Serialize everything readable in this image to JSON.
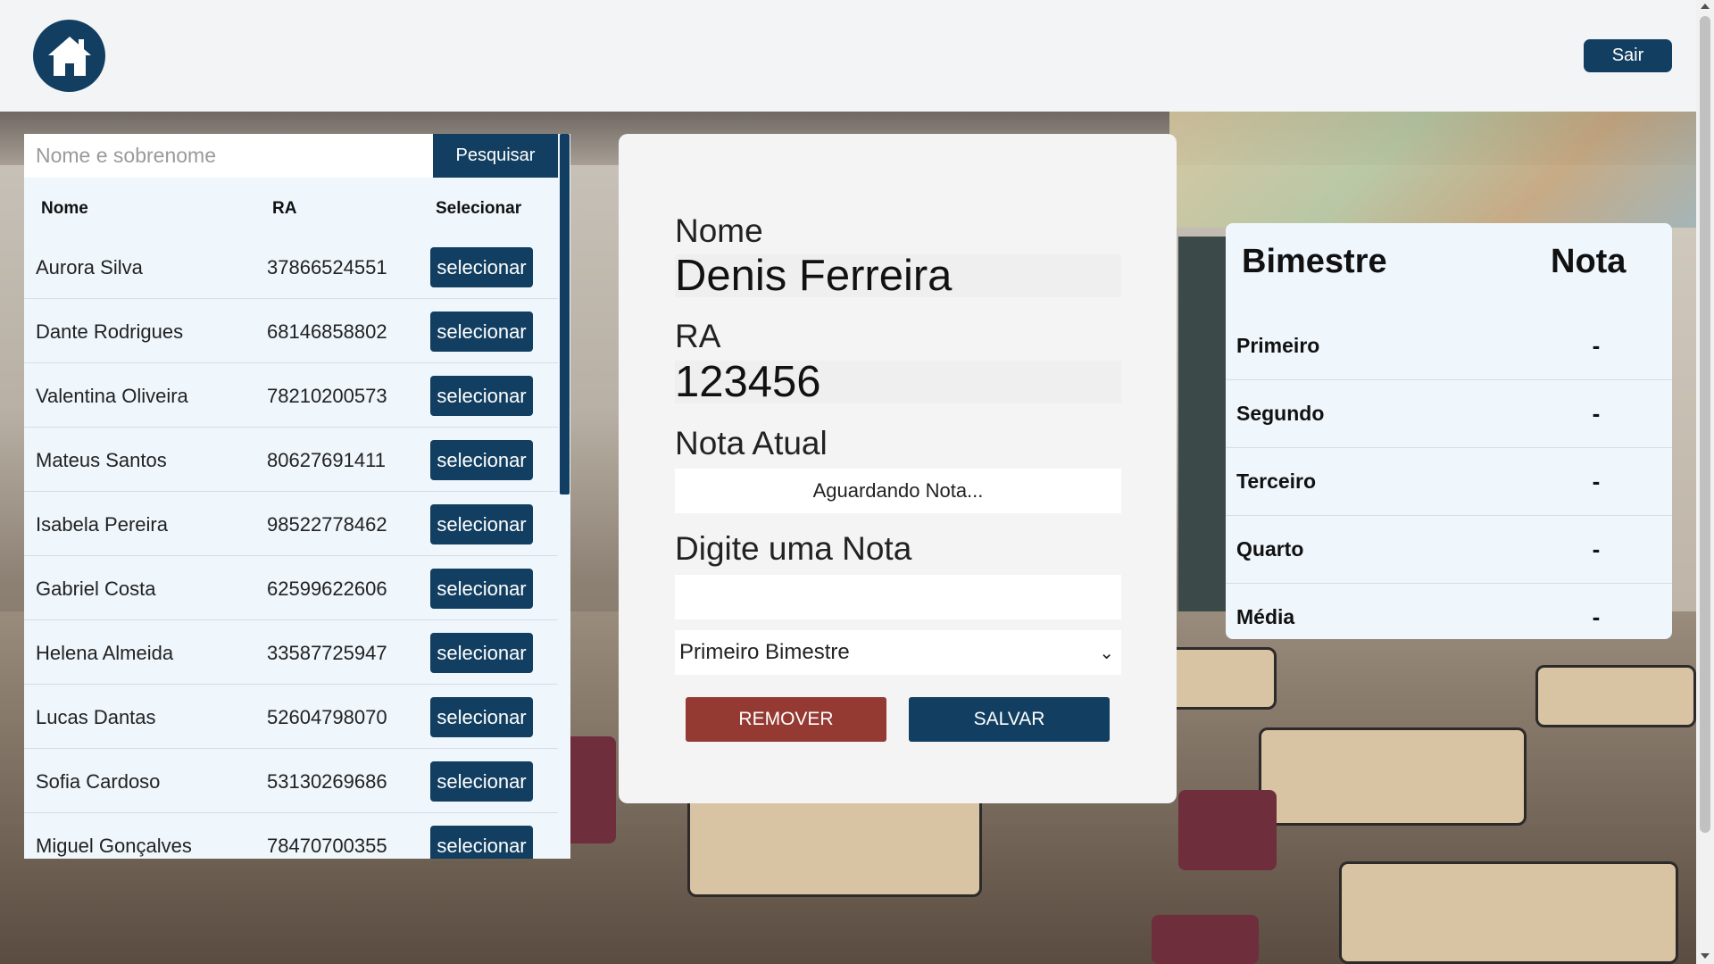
{
  "header": {
    "home_icon": "home-icon",
    "logout_label": "Sair"
  },
  "search": {
    "placeholder": "Nome e sobrenome",
    "button_label": "Pesquisar"
  },
  "students_table": {
    "columns": [
      "Nome",
      "RA",
      "Selecionar"
    ],
    "rows": [
      {
        "nome": "Aurora Silva",
        "ra": "37866524551",
        "action": "selecionar"
      },
      {
        "nome": "Dante Rodrigues",
        "ra": "68146858802",
        "action": "selecionar"
      },
      {
        "nome": "Valentina Oliveira",
        "ra": "78210200573",
        "action": "selecionar"
      },
      {
        "nome": "Mateus Santos",
        "ra": "80627691411",
        "action": "selecionar"
      },
      {
        "nome": "Isabela Pereira",
        "ra": "98522778462",
        "action": "selecionar"
      },
      {
        "nome": "Gabriel Costa",
        "ra": "62599622606",
        "action": "selecionar"
      },
      {
        "nome": "Helena Almeida",
        "ra": "33587725947",
        "action": "selecionar"
      },
      {
        "nome": "Lucas Dantas",
        "ra": "52604798070",
        "action": "selecionar"
      },
      {
        "nome": "Sofia Cardoso",
        "ra": "53130269686",
        "action": "selecionar"
      },
      {
        "nome": "Miguel Gonçalves",
        "ra": "78470700355",
        "action": "selecionar"
      }
    ]
  },
  "form": {
    "nome_label": "Nome",
    "nome_value": "Denis Ferreira",
    "ra_label": "RA",
    "ra_value": "123456",
    "nota_atual_label": "Nota Atual",
    "nota_atual_value": "Aguardando Nota...",
    "digite_label": "Digite uma Nota",
    "nota_input_value": "",
    "bimestre_selected": "Primeiro Bimestre",
    "remove_label": "REMOVER",
    "save_label": "SALVAR"
  },
  "grades": {
    "header_bimestre": "Bimestre",
    "header_nota": "Nota",
    "rows": [
      {
        "name": "Primeiro",
        "value": "-"
      },
      {
        "name": "Segundo",
        "value": "-"
      },
      {
        "name": "Terceiro",
        "value": "-"
      },
      {
        "name": "Quarto",
        "value": "-"
      },
      {
        "name": "Média",
        "value": "-"
      }
    ]
  },
  "colors": {
    "primary": "#123f61",
    "danger": "#943a32",
    "panel": "#eff6fc"
  }
}
